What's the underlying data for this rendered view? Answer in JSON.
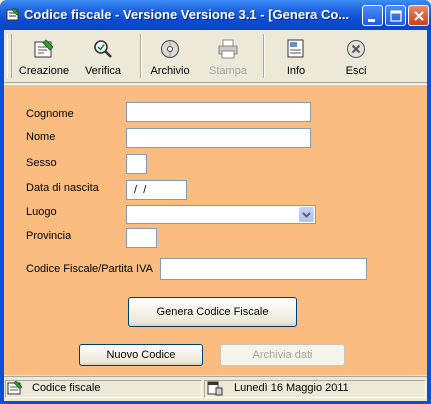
{
  "window": {
    "title": "Codice fiscale - Versione Versione 3.1 - [Genera Co...",
    "title_bar_color": "#0a4fd6"
  },
  "window_controls": [
    {
      "name": "minimize-icon"
    },
    {
      "name": "maximize-icon"
    },
    {
      "name": "close-icon"
    }
  ],
  "toolbar": {
    "items": [
      {
        "label": "Creazione",
        "icon": "create-form-icon",
        "enabled": true
      },
      {
        "label": "Verifica",
        "icon": "magnifier-check-icon",
        "enabled": true
      },
      {
        "label": "Archivio",
        "icon": "archive-disk-icon",
        "enabled": true
      },
      {
        "label": "Stampa",
        "icon": "printer-icon",
        "enabled": false
      },
      {
        "label": "Info",
        "icon": "info-document-icon",
        "enabled": true
      },
      {
        "label": "Esci",
        "icon": "exit-x-icon",
        "enabled": true
      }
    ]
  },
  "form": {
    "background": "#fbbd7f",
    "cognome_label": "Cognome",
    "cognome_value": "",
    "nome_label": "Nome",
    "nome_value": "",
    "sesso_label": "Sesso",
    "sesso_value": "",
    "data_nascita_label": "Data di nascita",
    "data_nascita_value": " /  /",
    "luogo_label": "Luogo",
    "luogo_value": "",
    "provincia_label": "Provincia",
    "provincia_value": "",
    "codice_label": "Codice Fiscale/Partita IVA",
    "codice_value": "",
    "genera_button": "Genera Codice Fiscale",
    "nuovo_button": "Nuovo Codice",
    "archivia_button": "Archivia dati"
  },
  "status": {
    "left_text": "Codice fiscale",
    "right_text": "Lunedì 16 Maggio 2011"
  }
}
